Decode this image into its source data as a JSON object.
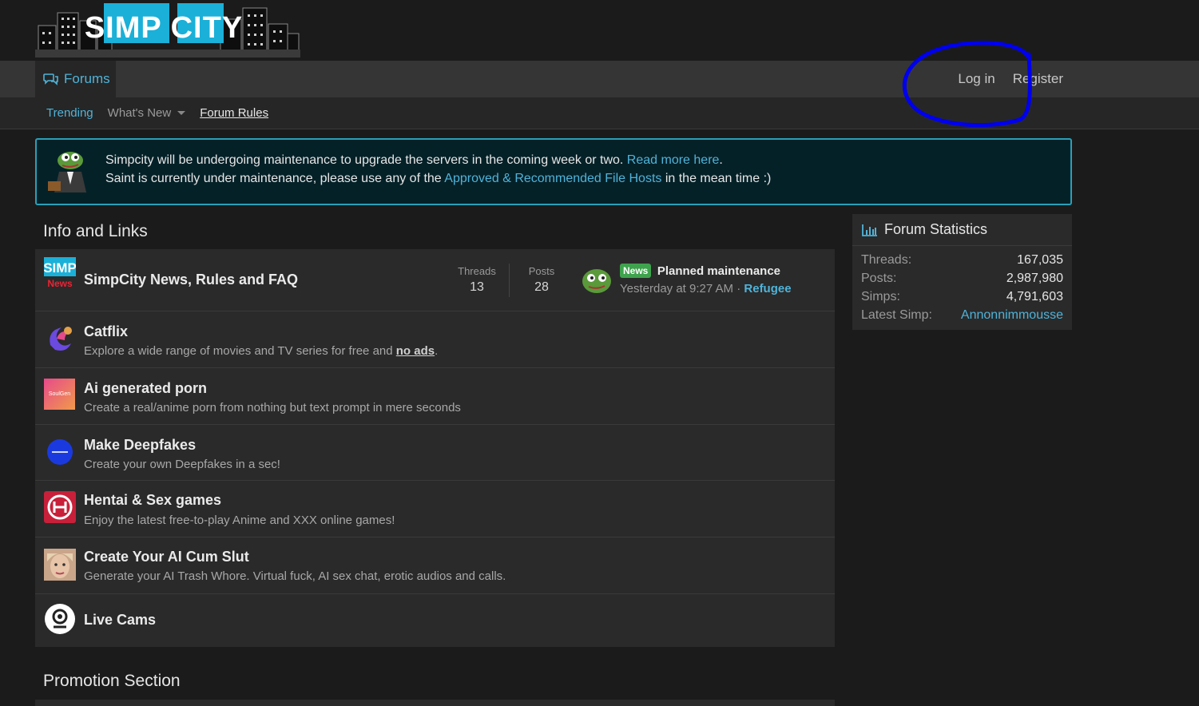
{
  "header": {
    "logo_text": "SIMP CITY"
  },
  "nav": {
    "forums_label": "Forums",
    "login_label": "Log in",
    "register_label": "Register"
  },
  "subnav": {
    "trending": "Trending",
    "whats_new": "What's New",
    "forum_rules": "Forum Rules"
  },
  "notice": {
    "line1_pre": "Simpcity will be undergoing maintenance to upgrade the servers in the coming week or two. ",
    "line1_link": "Read more here",
    "line1_post": ".",
    "line2_pre": "Saint is currently under maintenance, please use any of the ",
    "line2_link": "Approved & Recommended File Hosts",
    "line2_post": " in the mean time :)"
  },
  "info": {
    "title": "Info and Links",
    "news_forum": {
      "title": "SimpCity News, Rules and FAQ",
      "icon_top": "SIMP",
      "icon_bottom": "News",
      "threads_label": "Threads",
      "threads_value": "13",
      "posts_label": "Posts",
      "posts_value": "28",
      "latest_badge": "News",
      "latest_title": "Planned maintenance",
      "latest_time": "Yesterday at 9:27 AM",
      "latest_sep": " · ",
      "latest_user": "Refugee"
    },
    "links": [
      {
        "title": "Catflix",
        "desc_pre": "Explore a wide range of movies and TV series for free and ",
        "desc_bold": "no ads",
        "desc_post": "."
      },
      {
        "title": "Ai generated porn",
        "desc": "Create a real/anime porn from nothing but text prompt in mere seconds",
        "icon_text": "SoulGen"
      },
      {
        "title": "Make Deepfakes",
        "desc": "Create your own Deepfakes in a sec!"
      },
      {
        "title": "Hentai & Sex games",
        "desc": "Enjoy the latest free-to-play Anime and XXX online games!"
      },
      {
        "title": "Create Your AI Cum Slut",
        "desc": "Generate your AI Trash Whore. Virtual fuck, AI sex chat, erotic audios and calls."
      },
      {
        "title": "Live Cams"
      }
    ]
  },
  "stats": {
    "title": "Forum Statistics",
    "rows": [
      {
        "label": "Threads:",
        "value": "167,035"
      },
      {
        "label": "Posts:",
        "value": "2,987,980"
      },
      {
        "label": "Simps:",
        "value": "4,791,603"
      },
      {
        "label": "Latest Simp:",
        "value": "Annonnimmousse"
      }
    ]
  },
  "promo": {
    "title": "Promotion Section"
  },
  "colors": {
    "accent": "#4fb3d9",
    "notice_border": "#2a9fb8",
    "badge": "#3fa34d",
    "annotation": "#0000ee"
  }
}
